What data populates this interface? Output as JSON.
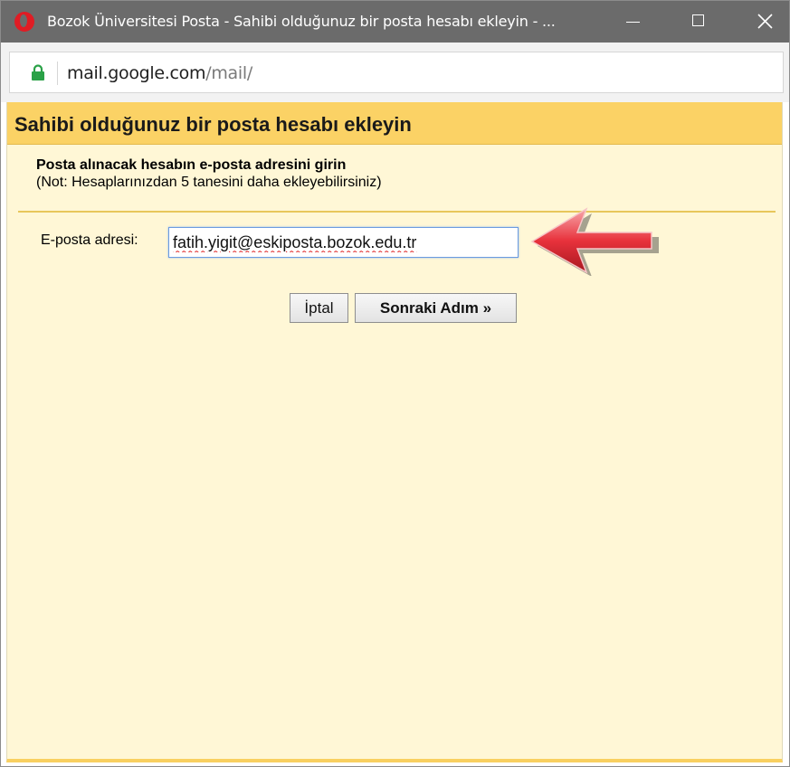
{
  "window": {
    "title": "Bozok Üniversitesi Posta - Sahibi olduğunuz bir posta hesabı ekleyin - ..."
  },
  "address_bar": {
    "host": "mail.google.com",
    "path": "/mail/"
  },
  "dialog": {
    "title": "Sahibi olduğunuz bir posta hesabı ekleyin",
    "instruction": "Posta alınacak hesabın e-posta adresini girin",
    "note": "(Not: Hesaplarınızdan 5 tanesini daha ekleyebilirsiniz)",
    "email_label": "E-posta adresi:",
    "email_value": "fatih.yigit@eskiposta.bozok.edu.tr",
    "cancel_label": "İptal",
    "next_label": "Sonraki Adım »"
  },
  "colors": {
    "titlebar": "#6b6b6b",
    "dialog_header": "#fbd265",
    "dialog_body": "#fff7d6",
    "arrow": "#e8323c"
  }
}
